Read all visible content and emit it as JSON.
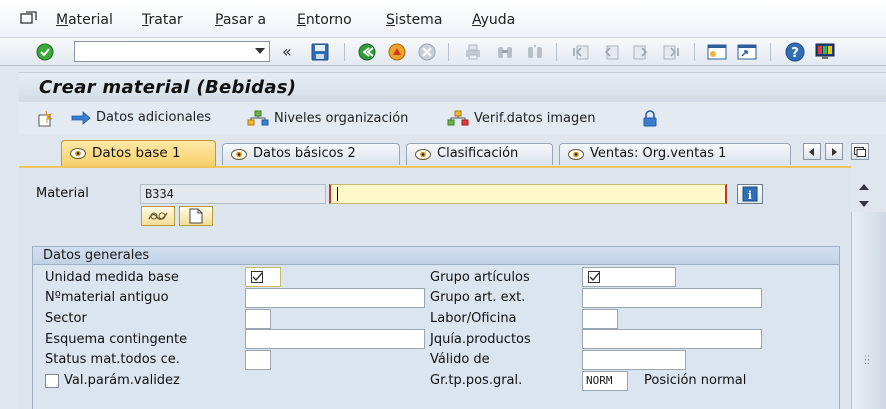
{
  "menu": {
    "items": [
      {
        "id": "material",
        "first": "M",
        "rest": "aterial"
      },
      {
        "id": "tratar",
        "first": "T",
        "rest": "ratar"
      },
      {
        "id": "pasar",
        "first": "P",
        "rest": "asar a"
      },
      {
        "id": "entorno",
        "first": "E",
        "rest": "ntorno"
      },
      {
        "id": "sistema",
        "first": "S",
        "rest": "istema"
      },
      {
        "id": "ayuda",
        "first": "A",
        "rest": "yuda"
      }
    ]
  },
  "toolbar": {
    "command_value": "",
    "back_symbol": "«",
    "icons": [
      "enter-icon",
      "save-icon",
      "back-icon",
      "exit-icon",
      "cancel-icon",
      "print-icon",
      "find-icon",
      "find-next-icon",
      "first-page-icon",
      "previous-page-icon",
      "next-page-icon",
      "last-page-icon",
      "create-session-icon",
      "shortcut-icon",
      "help-icon",
      "layout-menu-icon"
    ]
  },
  "title": "Crear material (Bebidas)",
  "app_toolbar": {
    "datos_adicionales": "Datos adicionales",
    "niveles_organizacion": "Niveles organización",
    "verif_datos_imagen": "Verif.datos imagen"
  },
  "tabs": [
    {
      "label": "Datos base 1",
      "active": true
    },
    {
      "label": "Datos básicos 2",
      "active": false
    },
    {
      "label": "Clasificación",
      "active": false
    },
    {
      "label": "Ventas: Org.ventas 1",
      "active": false
    }
  ],
  "header": {
    "material_label": "Material",
    "material_value": "B334",
    "description_value": ""
  },
  "group": {
    "title": "Datos generales",
    "left": [
      {
        "label": "Unidad medida base",
        "value": ""
      },
      {
        "label": "Nºmaterial antiguo",
        "value": ""
      },
      {
        "label": "Sector",
        "value": ""
      },
      {
        "label": "Esquema contingente",
        "value": ""
      },
      {
        "label": "Status mat.todos ce.",
        "value": ""
      }
    ],
    "checkbox_label": "Val.parám.validez",
    "right": [
      {
        "label": "Grupo artículos",
        "value": ""
      },
      {
        "label": "Grupo art. ext.",
        "value": ""
      },
      {
        "label": "Labor/Oficina",
        "value": ""
      },
      {
        "label": "Jquía.productos",
        "value": ""
      },
      {
        "label": "Válido de",
        "value": ""
      },
      {
        "label": "Gr.tp.pos.gral.",
        "value": "NORM"
      }
    ],
    "position_text": "Posición normal"
  },
  "colors": {
    "active_tab": "#f6cf6a",
    "required_field": "#fff8c8",
    "background": "#dfe6ee"
  }
}
